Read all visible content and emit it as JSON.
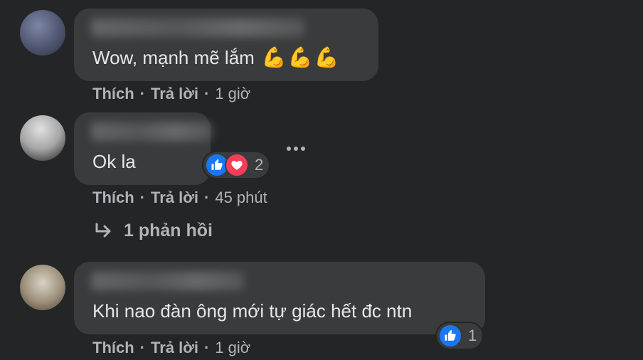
{
  "comments": [
    {
      "text": "Wow, mạnh mẽ lắm",
      "emojis": [
        "💪",
        "💪",
        "💪"
      ],
      "actions": {
        "like": "Thích",
        "reply": "Trả lời",
        "time": "1 giờ"
      }
    },
    {
      "text": "Ok la",
      "reactions": {
        "count": "2",
        "types": [
          "like-icon",
          "heart-icon"
        ]
      },
      "actions": {
        "like": "Thích",
        "reply": "Trả lời",
        "time": "45 phút"
      },
      "replies_link": "1 phản hồi"
    },
    {
      "text": "Khi nao đàn ông mới tự giác hết đc ntn",
      "reactions": {
        "count": "1",
        "types": [
          "like-icon"
        ]
      },
      "actions": {
        "like": "Thích",
        "reply": "Trả lời",
        "time": "1 giờ"
      }
    }
  ],
  "colors": {
    "background": "#242526",
    "bubble": "#3a3b3c",
    "text": "#e4e6eb",
    "secondary_text": "#b0b3b8",
    "like_blue": "#1877f2",
    "love_red": "#f33e58"
  }
}
